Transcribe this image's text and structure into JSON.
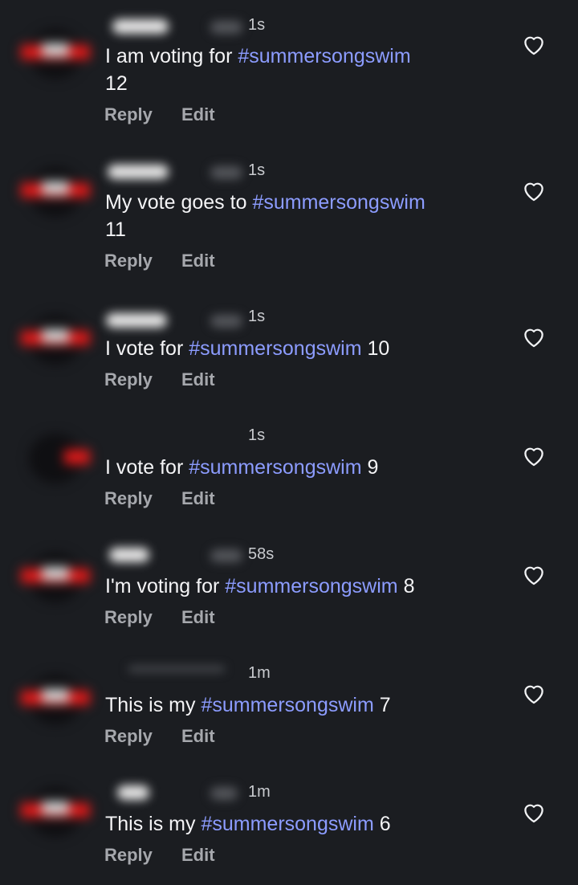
{
  "actions": {
    "reply": "Reply",
    "edit": "Edit"
  },
  "icons": {
    "like": "heart-outline-icon"
  },
  "colors": {
    "background": "#1b1d21",
    "hashtag": "#8c9cff",
    "action": "#a6a8ad"
  },
  "comments": [
    {
      "time": "1s",
      "prefix": "I am voting for ",
      "hashtag": "#summersongswim",
      "suffix": "\n12"
    },
    {
      "time": "1s",
      "prefix": "My vote goes to ",
      "hashtag": "#summersongswim",
      "suffix": "\n11"
    },
    {
      "time": "1s",
      "prefix": "I vote for ",
      "hashtag": "#summersongswim",
      "suffix": " 10"
    },
    {
      "time": "1s",
      "prefix": "I vote for ",
      "hashtag": "#summersongswim",
      "suffix": " 9"
    },
    {
      "time": "58s",
      "prefix": "I'm voting for ",
      "hashtag": "#summersongswim",
      "suffix": " 8"
    },
    {
      "time": "1m",
      "prefix": "This is my ",
      "hashtag": "#summersongswim",
      "suffix": " 7"
    },
    {
      "time": "1m",
      "prefix": "This is my ",
      "hashtag": "#summersongswim",
      "suffix": " 6"
    }
  ]
}
